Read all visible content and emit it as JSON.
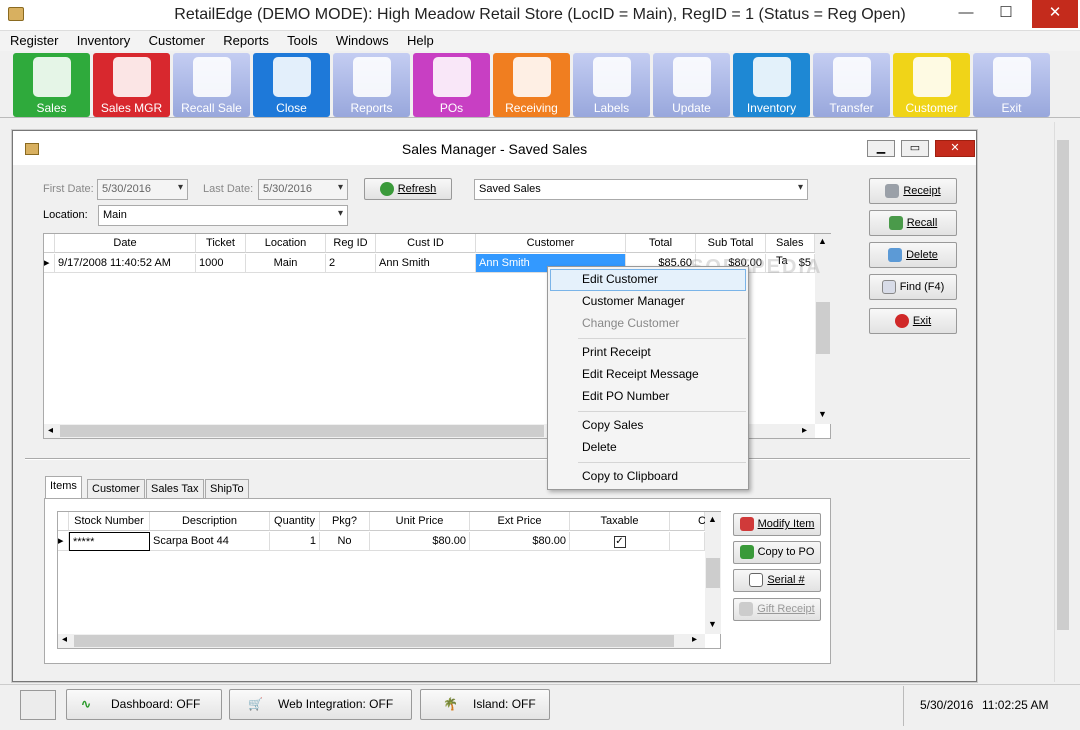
{
  "window": {
    "title": "RetailEdge (DEMO MODE): High Meadow Retail Store (LocID = Main),  RegID = 1 (Status = Reg Open)",
    "minimize": "—",
    "maximize": "☐",
    "close": "✕"
  },
  "menu": [
    "Register",
    "Inventory",
    "Customer",
    "Reports",
    "Tools",
    "Windows",
    "Help"
  ],
  "toolbar": [
    {
      "label": "Sales",
      "color": "#2faa3c",
      "icon": "sales-icon"
    },
    {
      "label": "Sales MGR",
      "color": "#d8282e",
      "icon": "sales-mgr-icon"
    },
    {
      "label": "Recall Sale",
      "color": "#a7b4e6",
      "icon": "recall-sale-icon"
    },
    {
      "label": "Close",
      "color": "#1e79d9",
      "icon": "close-register-icon"
    },
    {
      "label": "Reports",
      "color": "#a7b4e6",
      "icon": "reports-icon"
    },
    {
      "label": "POs",
      "color": "#c83fc3",
      "icon": "pos-icon"
    },
    {
      "label": "Receiving",
      "color": "#f07e20",
      "icon": "receiving-icon"
    },
    {
      "label": "Labels",
      "color": "#a7b4e6",
      "icon": "labels-icon"
    },
    {
      "label": "Update",
      "color": "#a7b4e6",
      "icon": "update-icon"
    },
    {
      "label": "Inventory",
      "color": "#1e88d4",
      "icon": "inventory-icon"
    },
    {
      "label": "Transfer",
      "color": "#a7b4e6",
      "icon": "transfer-icon"
    },
    {
      "label": "Customer",
      "color": "#f0d418",
      "icon": "customer-icon"
    },
    {
      "label": "Exit",
      "color": "#a7b4e6",
      "icon": "exit-icon"
    }
  ],
  "dialog": {
    "title": "Sales Manager - Saved Sales",
    "first_date_label": "First Date:",
    "first_date": "5/30/2016",
    "last_date_label": "Last Date:",
    "last_date": "5/30/2016",
    "refresh": "Refresh",
    "view_select": "Saved Sales",
    "location_label": "Location:",
    "location": "Main"
  },
  "side_buttons": [
    "Receipt",
    "Recall",
    "Delete",
    "Find (F4)",
    "Exit"
  ],
  "sales_grid": {
    "headers": [
      "Date",
      "Ticket",
      "Location",
      "Reg ID",
      "Cust ID",
      "Customer",
      "Total",
      "Sub Total",
      "Sales Ta"
    ],
    "row": [
      "9/17/2008 11:40:52 AM",
      "1000",
      "Main",
      "2",
      "Ann Smith",
      "Ann Smith",
      "$85.60",
      "$80.00",
      "$5"
    ]
  },
  "context_menu": [
    "Edit Customer",
    "Customer Manager",
    "Change Customer",
    "Print Receipt",
    "Edit Receipt Message",
    "Edit PO Number",
    "Copy Sales",
    "Delete",
    "Copy to Clipboard"
  ],
  "tabs": [
    "Items",
    "Customer",
    "Sales Tax",
    "ShipTo"
  ],
  "items_grid": {
    "headers": [
      "Stock Number",
      "Description",
      "Quantity",
      "Pkg?",
      "Unit Price",
      "Ext Price",
      "Taxable",
      "C"
    ],
    "row": [
      "*****",
      "Scarpa Boot 44",
      "1",
      "No",
      "$80.00",
      "$80.00",
      "✓",
      ""
    ]
  },
  "item_buttons": [
    "Modify Item",
    "Copy to PO",
    "Serial #",
    "Gift Receipt"
  ],
  "status": {
    "dashboard": "Dashboard: OFF",
    "web": "Web Integration: OFF",
    "island": "Island: OFF",
    "date": "5/30/2016",
    "time": "11:02:25 AM"
  },
  "watermark": "SOFTPEDIA"
}
